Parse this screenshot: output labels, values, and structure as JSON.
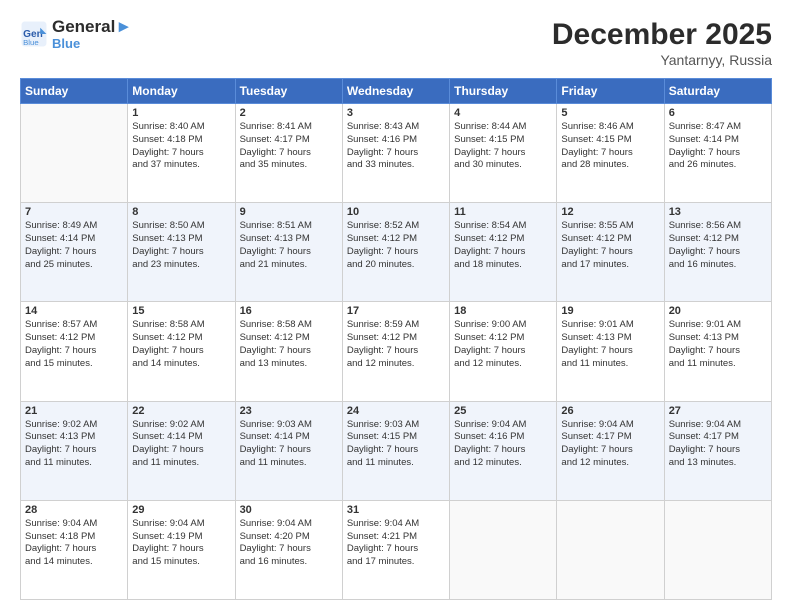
{
  "header": {
    "logo_line1": "General",
    "logo_line2": "Blue",
    "month": "December 2025",
    "location": "Yantarnyy, Russia"
  },
  "weekdays": [
    "Sunday",
    "Monday",
    "Tuesday",
    "Wednesday",
    "Thursday",
    "Friday",
    "Saturday"
  ],
  "weeks": [
    [
      {
        "day": "",
        "text": ""
      },
      {
        "day": "1",
        "text": "Sunrise: 8:40 AM\nSunset: 4:18 PM\nDaylight: 7 hours\nand 37 minutes."
      },
      {
        "day": "2",
        "text": "Sunrise: 8:41 AM\nSunset: 4:17 PM\nDaylight: 7 hours\nand 35 minutes."
      },
      {
        "day": "3",
        "text": "Sunrise: 8:43 AM\nSunset: 4:16 PM\nDaylight: 7 hours\nand 33 minutes."
      },
      {
        "day": "4",
        "text": "Sunrise: 8:44 AM\nSunset: 4:15 PM\nDaylight: 7 hours\nand 30 minutes."
      },
      {
        "day": "5",
        "text": "Sunrise: 8:46 AM\nSunset: 4:15 PM\nDaylight: 7 hours\nand 28 minutes."
      },
      {
        "day": "6",
        "text": "Sunrise: 8:47 AM\nSunset: 4:14 PM\nDaylight: 7 hours\nand 26 minutes."
      }
    ],
    [
      {
        "day": "7",
        "text": "Sunrise: 8:49 AM\nSunset: 4:14 PM\nDaylight: 7 hours\nand 25 minutes."
      },
      {
        "day": "8",
        "text": "Sunrise: 8:50 AM\nSunset: 4:13 PM\nDaylight: 7 hours\nand 23 minutes."
      },
      {
        "day": "9",
        "text": "Sunrise: 8:51 AM\nSunset: 4:13 PM\nDaylight: 7 hours\nand 21 minutes."
      },
      {
        "day": "10",
        "text": "Sunrise: 8:52 AM\nSunset: 4:12 PM\nDaylight: 7 hours\nand 20 minutes."
      },
      {
        "day": "11",
        "text": "Sunrise: 8:54 AM\nSunset: 4:12 PM\nDaylight: 7 hours\nand 18 minutes."
      },
      {
        "day": "12",
        "text": "Sunrise: 8:55 AM\nSunset: 4:12 PM\nDaylight: 7 hours\nand 17 minutes."
      },
      {
        "day": "13",
        "text": "Sunrise: 8:56 AM\nSunset: 4:12 PM\nDaylight: 7 hours\nand 16 minutes."
      }
    ],
    [
      {
        "day": "14",
        "text": "Sunrise: 8:57 AM\nSunset: 4:12 PM\nDaylight: 7 hours\nand 15 minutes."
      },
      {
        "day": "15",
        "text": "Sunrise: 8:58 AM\nSunset: 4:12 PM\nDaylight: 7 hours\nand 14 minutes."
      },
      {
        "day": "16",
        "text": "Sunrise: 8:58 AM\nSunset: 4:12 PM\nDaylight: 7 hours\nand 13 minutes."
      },
      {
        "day": "17",
        "text": "Sunrise: 8:59 AM\nSunset: 4:12 PM\nDaylight: 7 hours\nand 12 minutes."
      },
      {
        "day": "18",
        "text": "Sunrise: 9:00 AM\nSunset: 4:12 PM\nDaylight: 7 hours\nand 12 minutes."
      },
      {
        "day": "19",
        "text": "Sunrise: 9:01 AM\nSunset: 4:13 PM\nDaylight: 7 hours\nand 11 minutes."
      },
      {
        "day": "20",
        "text": "Sunrise: 9:01 AM\nSunset: 4:13 PM\nDaylight: 7 hours\nand 11 minutes."
      }
    ],
    [
      {
        "day": "21",
        "text": "Sunrise: 9:02 AM\nSunset: 4:13 PM\nDaylight: 7 hours\nand 11 minutes."
      },
      {
        "day": "22",
        "text": "Sunrise: 9:02 AM\nSunset: 4:14 PM\nDaylight: 7 hours\nand 11 minutes."
      },
      {
        "day": "23",
        "text": "Sunrise: 9:03 AM\nSunset: 4:14 PM\nDaylight: 7 hours\nand 11 minutes."
      },
      {
        "day": "24",
        "text": "Sunrise: 9:03 AM\nSunset: 4:15 PM\nDaylight: 7 hours\nand 11 minutes."
      },
      {
        "day": "25",
        "text": "Sunrise: 9:04 AM\nSunset: 4:16 PM\nDaylight: 7 hours\nand 12 minutes."
      },
      {
        "day": "26",
        "text": "Sunrise: 9:04 AM\nSunset: 4:17 PM\nDaylight: 7 hours\nand 12 minutes."
      },
      {
        "day": "27",
        "text": "Sunrise: 9:04 AM\nSunset: 4:17 PM\nDaylight: 7 hours\nand 13 minutes."
      }
    ],
    [
      {
        "day": "28",
        "text": "Sunrise: 9:04 AM\nSunset: 4:18 PM\nDaylight: 7 hours\nand 14 minutes."
      },
      {
        "day": "29",
        "text": "Sunrise: 9:04 AM\nSunset: 4:19 PM\nDaylight: 7 hours\nand 15 minutes."
      },
      {
        "day": "30",
        "text": "Sunrise: 9:04 AM\nSunset: 4:20 PM\nDaylight: 7 hours\nand 16 minutes."
      },
      {
        "day": "31",
        "text": "Sunrise: 9:04 AM\nSunset: 4:21 PM\nDaylight: 7 hours\nand 17 minutes."
      },
      {
        "day": "",
        "text": ""
      },
      {
        "day": "",
        "text": ""
      },
      {
        "day": "",
        "text": ""
      }
    ]
  ]
}
